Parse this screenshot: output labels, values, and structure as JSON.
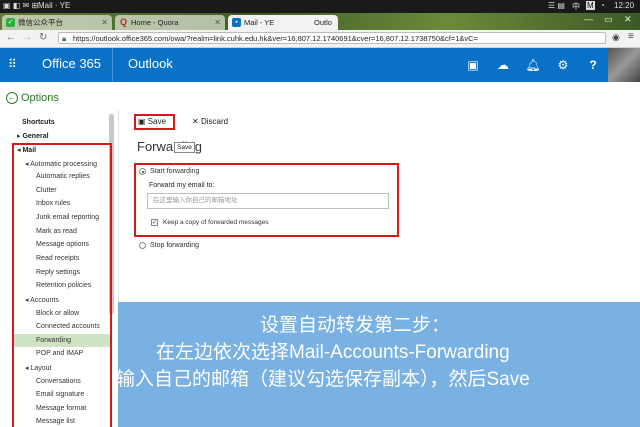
{
  "statusbar": {
    "mail": "Mail · YE",
    "time": "12:20",
    "lang": "中",
    "m": "M"
  },
  "tabs": [
    {
      "label": "微信公众平台",
      "icon_color": "#2fae3a"
    },
    {
      "label": "Home - Quora",
      "icon_color": "#b92b27"
    },
    {
      "label": "Mail - YE",
      "extra": "Outlo",
      "icon_color": "#0a72c6"
    }
  ],
  "addressbar": {
    "url": "https://outlook.office365.com/owa/?realm=link.cuhk.edu.hk&ver=16,807.12.1740691&cver=16,807.12.1738750&cf=1&vC="
  },
  "header": {
    "office": "Office 365",
    "app": "Outlook"
  },
  "options": {
    "title": "Options"
  },
  "sidebar": {
    "shortcuts": "Shortcuts",
    "general": "General",
    "mail": "Mail",
    "automatic_processing": "Automatic processing",
    "auto_items": [
      "Automatic replies",
      "Clutter",
      "Inbox rules",
      "Junk email reporting",
      "Mark as read",
      "Message options",
      "Read receipts",
      "Reply settings",
      "Retention policies"
    ],
    "accounts": "Accounts",
    "account_items": [
      "Block or allow",
      "Connected accounts",
      "Forwarding",
      "POP and IMAP"
    ],
    "layout": "Layout",
    "layout_items": [
      "Conversations",
      "Email signature",
      "Message format",
      "Message list"
    ]
  },
  "toolbar": {
    "save": "Save",
    "discard": "Discard"
  },
  "main": {
    "title": "Forwarding",
    "tooltip": "Save",
    "start_forwarding": "Start forwarding",
    "forward_label": "Forward my email to:",
    "email_placeholder": "在这里输入你自己的邮箱地址",
    "keep_copy": "Keep a copy of forwarded messages",
    "stop_forwarding": "Stop forwarding"
  },
  "overlay": {
    "line1": "设置自动转发第二步：",
    "line2": "在左边依次选择Mail-Accounts-Forwarding",
    "line3": "输入自己的邮箱（建议勾选保存副本），然后Save"
  },
  "colors": {
    "o365_blue": "#0a72c6",
    "highlight_red": "#d41b1b",
    "selected_green": "#cfe4c4",
    "options_green": "#2a7a2a",
    "overlay_blue": "#5aa0dc"
  }
}
